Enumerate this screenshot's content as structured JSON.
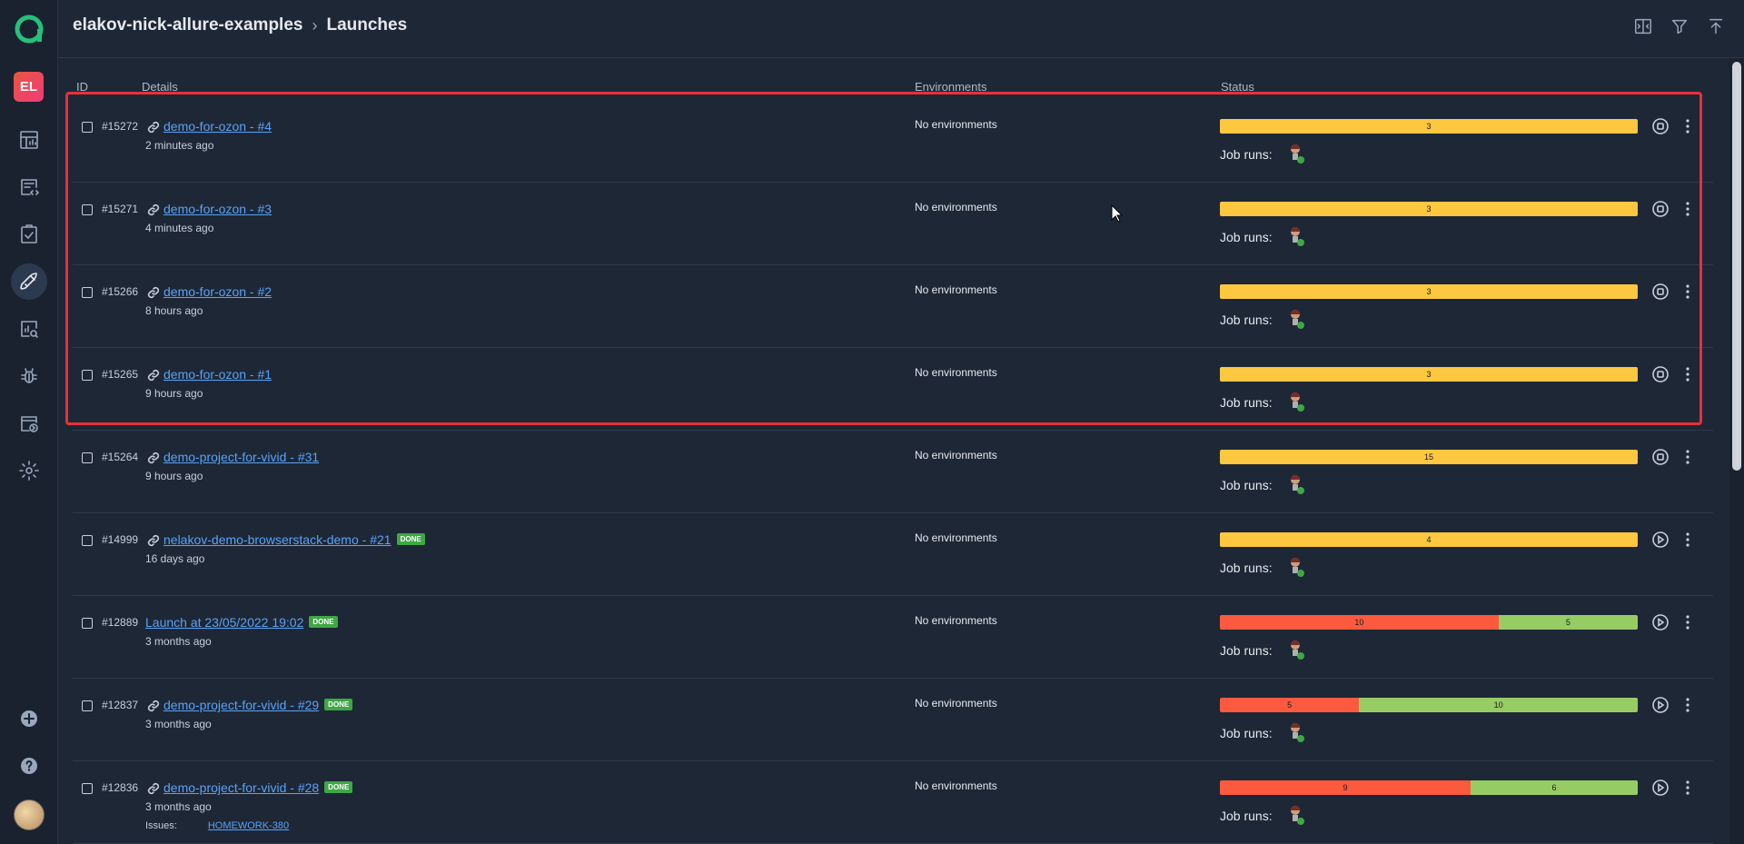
{
  "breadcrumb": {
    "project": "elakov-nick-allure-examples",
    "page": "Launches"
  },
  "sidebar": {
    "avatar_initials": "EL",
    "items": [
      {
        "name": "dashboards-icon"
      },
      {
        "name": "test-cases-icon"
      },
      {
        "name": "test-plans-icon"
      },
      {
        "name": "launches-icon",
        "active": true
      },
      {
        "name": "analytics-icon"
      },
      {
        "name": "defects-icon"
      },
      {
        "name": "jobs-icon"
      },
      {
        "name": "settings-icon"
      }
    ],
    "bottom": [
      {
        "name": "add-icon"
      },
      {
        "name": "help-icon"
      }
    ]
  },
  "table": {
    "headers": {
      "id": "ID",
      "details": "Details",
      "environments": "Environments",
      "status": "Status"
    },
    "job_runs_label": "Job runs:",
    "rows": [
      {
        "id": "#15272",
        "name": "demo-for-ozon - #4",
        "time": "2 minutes ago",
        "env": "No environments",
        "segments": [
          {
            "type": "broken",
            "value": "3"
          }
        ],
        "action": "stop"
      },
      {
        "id": "#15271",
        "name": "demo-for-ozon - #3",
        "time": "4 minutes ago",
        "env": "No environments",
        "segments": [
          {
            "type": "broken",
            "value": "3"
          }
        ],
        "action": "stop"
      },
      {
        "id": "#15266",
        "name": "demo-for-ozon - #2",
        "time": "8 hours ago",
        "env": "No environments",
        "segments": [
          {
            "type": "broken",
            "value": "3"
          }
        ],
        "action": "stop"
      },
      {
        "id": "#15265",
        "name": "demo-for-ozon - #1",
        "time": "9 hours ago",
        "env": "No environments",
        "segments": [
          {
            "type": "broken",
            "value": "3"
          }
        ],
        "action": "stop"
      },
      {
        "id": "#15264",
        "name": "demo-project-for-vivid - #31",
        "time": "9 hours ago",
        "env": "No environments",
        "segments": [
          {
            "type": "broken",
            "value": "15"
          }
        ],
        "action": "stop"
      },
      {
        "id": "#14999",
        "name": "nelakov-demo-browserstack-demo - #21",
        "badge": "DONE",
        "time": "16 days ago",
        "env": "No environments",
        "segments": [
          {
            "type": "broken",
            "value": "4"
          }
        ],
        "action": "play"
      },
      {
        "id": "#12889",
        "name": "Launch at 23/05/2022 19:02",
        "badge": "DONE",
        "nolink": true,
        "time": "3 months ago",
        "env": "No environments",
        "segments": [
          {
            "type": "failed",
            "value": "10"
          },
          {
            "type": "passed",
            "value": "5"
          }
        ],
        "action": "play"
      },
      {
        "id": "#12837",
        "name": "demo-project-for-vivid - #29",
        "badge": "DONE",
        "time": "3 months ago",
        "env": "No environments",
        "segments": [
          {
            "type": "failed",
            "value": "5"
          },
          {
            "type": "passed",
            "value": "10"
          }
        ],
        "action": "play"
      },
      {
        "id": "#12836",
        "name": "demo-project-for-vivid - #28",
        "badge": "DONE",
        "time": "3 months ago",
        "env": "No environments",
        "segments": [
          {
            "type": "failed",
            "value": "9"
          },
          {
            "type": "passed",
            "value": "6"
          }
        ],
        "action": "play",
        "issues_label": "Issues:",
        "issue": "HOMEWORK-380"
      }
    ]
  },
  "colors": {
    "broken": "#fdc740",
    "failed": "#fb5a3f",
    "passed": "#97cc64",
    "link": "#5aa2f5",
    "highlight": "#e8303a"
  }
}
